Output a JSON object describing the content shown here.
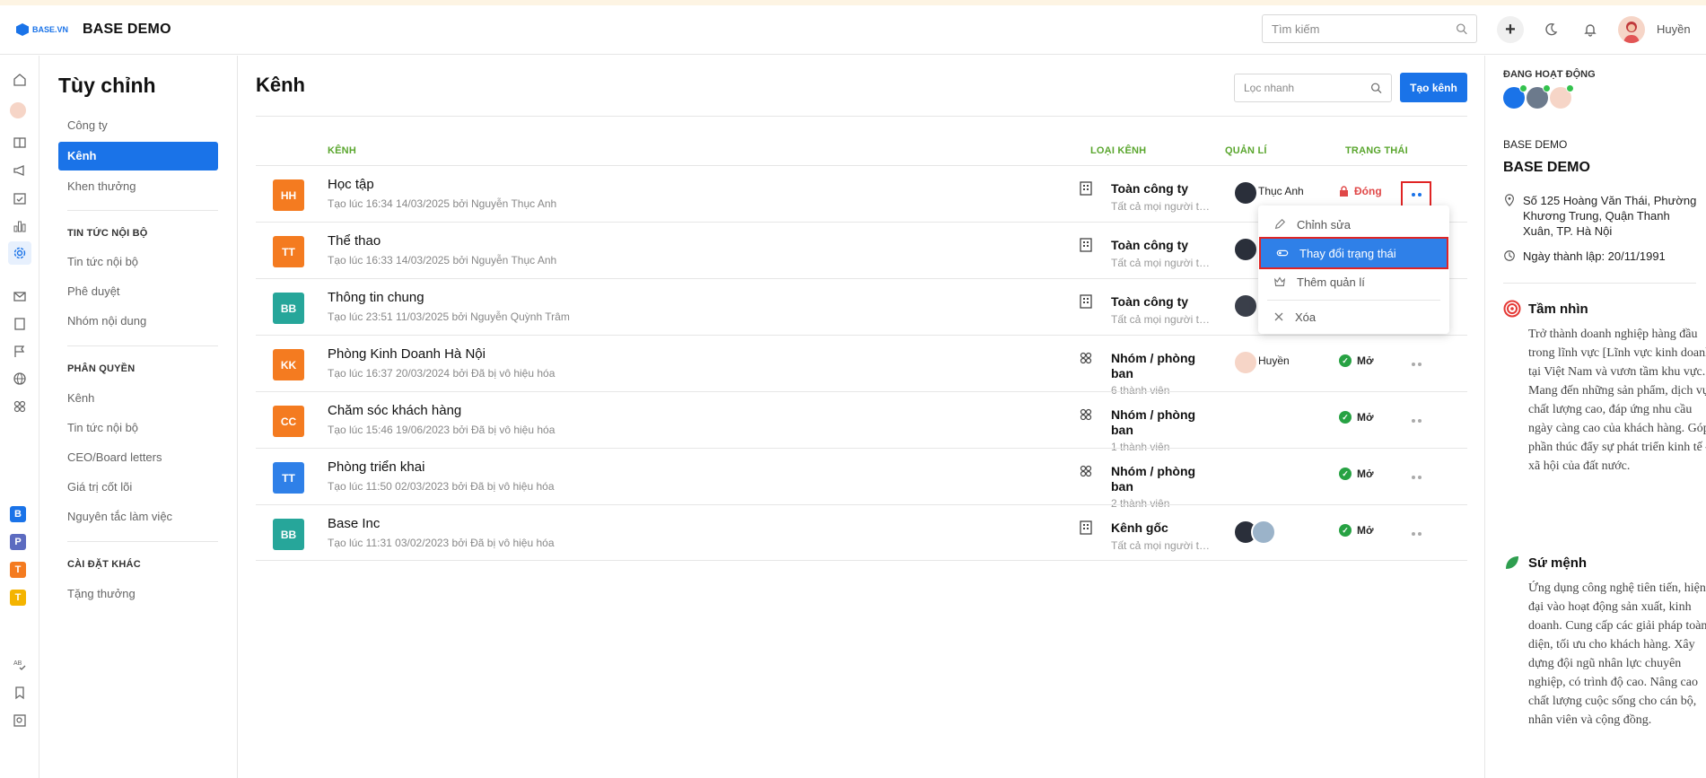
{
  "header": {
    "brand_logo_text": "BASE.VN",
    "brand_name": "BASE DEMO",
    "search_placeholder": "Tìm kiếm",
    "user_name": "Huyền"
  },
  "sidebar": {
    "title": "Tùy chỉnh",
    "items": [
      {
        "label": "Công ty"
      },
      {
        "label": "Kênh",
        "active": true
      },
      {
        "label": "Khen thưởng"
      }
    ],
    "sections": [
      {
        "title": "TIN TỨC NỘI BỘ",
        "items": [
          "Tin tức nội bộ",
          "Phê duyệt",
          "Nhóm nội dung"
        ]
      },
      {
        "title": "PHÂN QUYỀN",
        "items": [
          "Kênh",
          "Tin tức nội bộ",
          "CEO/Board letters",
          "Giá trị cốt lõi",
          "Nguyên tắc làm việc"
        ]
      },
      {
        "title": "CÀI ĐẶT KHÁC",
        "items": [
          "Tặng thưởng"
        ]
      }
    ]
  },
  "apps": [
    {
      "letter": "B",
      "color": "#1a73e8"
    },
    {
      "letter": "P",
      "color": "#5c6bc0"
    },
    {
      "letter": "T",
      "color": "#f47b20"
    },
    {
      "letter": "T",
      "color": "#f4b400"
    }
  ],
  "main": {
    "title": "Kênh",
    "filter_placeholder": "Lọc nhanh",
    "create_label": "Tạo kênh",
    "columns": {
      "channel": "KÊNH",
      "type": "LOẠI KÊNH",
      "manager": "QUẢN LÍ",
      "status": "TRẠNG THÁI"
    },
    "rows": [
      {
        "initials": "HH",
        "color": "#f47b20",
        "name": "Học tập",
        "created": "Tạo lúc 16:34 14/03/2025 bởi Nguyễn Thục Anh",
        "type": "Toàn công ty",
        "type_sub": "Tất cả mọi người trong công ty",
        "manager": "Thục Anh",
        "status": "Đóng"
      },
      {
        "initials": "TT",
        "color": "#f47b20",
        "name": "Thể thao",
        "created": "Tạo lúc 16:33 14/03/2025 bởi Nguyễn Thục Anh",
        "type": "Toàn công ty",
        "type_sub": "Tất cả mọi người trong công ty",
        "manager": "",
        "status": ""
      },
      {
        "initials": "BB",
        "color": "#26a69a",
        "name": "Thông tin chung",
        "created": "Tạo lúc 23:51 11/03/2025 bởi Nguyễn Quỳnh Trâm",
        "type": "Toàn công ty",
        "type_sub": "Tất cả mọi người trong công ty",
        "manager": "",
        "status": ""
      },
      {
        "initials": "KK",
        "color": "#f47b20",
        "name": "Phòng Kinh Doanh Hà Nội",
        "created": "Tạo lúc 16:37 20/03/2024 bởi Đã bị vô hiệu hóa",
        "type": "Nhóm / phòng ban",
        "type_sub": "6 thành viên",
        "manager": "Huyền",
        "status": "Mở"
      },
      {
        "initials": "CC",
        "color": "#f47b20",
        "name": "Chăm sóc khách hàng",
        "created": "Tạo lúc 15:46 19/06/2023 bởi Đã bị vô hiệu hóa",
        "type": "Nhóm / phòng ban",
        "type_sub": "1 thành viên",
        "manager": "",
        "status": "Mở"
      },
      {
        "initials": "TT",
        "color": "#2f80e8",
        "name": "Phòng triển khai",
        "created": "Tạo lúc 11:50 02/03/2023 bởi Đã bị vô hiệu hóa",
        "type": "Nhóm / phòng ban",
        "type_sub": "2 thành viên",
        "manager": "",
        "status": "Mở"
      },
      {
        "initials": "BB",
        "color": "#26a69a",
        "name": "Base Inc",
        "created": "Tạo lúc 11:31 03/02/2023 bởi Đã bị vô hiệu hóa",
        "type": "Kênh gốc",
        "type_sub": "Tất cả mọi người trong công ty",
        "manager": "",
        "status": "Mở"
      }
    ],
    "menu": {
      "edit": "Chỉnh sửa",
      "change_status": "Thay đổi trạng thái",
      "add_manager": "Thêm quản lí",
      "delete": "Xóa"
    }
  },
  "right_panel": {
    "active_title": "ĐANG HOẠT ĐỘNG",
    "company_label": "BASE DEMO",
    "company_name": "BASE DEMO",
    "address": "Số 125 Hoàng Văn Thái, Phường Khương Trung, Quận Thanh Xuân, TP. Hà Nội",
    "founded": "Ngày thành lập: 20/11/1991",
    "vision_title": "Tầm nhìn",
    "vision_text": "Trở thành doanh nghiệp hàng đầu trong lĩnh vực [Lĩnh vực kinh doanh] tại Việt Nam và vươn tầm khu vực. Mang đến những sản phẩm, dịch vụ chất lượng cao, đáp ứng nhu cầu ngày càng cao của khách hàng. Góp phần thúc đẩy sự phát triển kinh tế – xã hội của đất nước.",
    "mission_title": "Sứ mệnh",
    "mission_text": "Ứng dụng công nghệ tiên tiến, hiện đại vào hoạt động sản xuất, kinh doanh. Cung cấp các giải pháp toàn diện, tối ưu cho khách hàng. Xây dựng đội ngũ nhân lực chuyên nghiệp, có trình độ cao. Nâng cao chất lượng cuộc sống cho cán bộ, nhân viên và cộng đồng."
  },
  "colors": {
    "accent": "#1a73e8",
    "green_header": "#5aa62e",
    "closed_red": "#e04848",
    "open_green": "#27a243",
    "highlight_red": "#e02424"
  }
}
